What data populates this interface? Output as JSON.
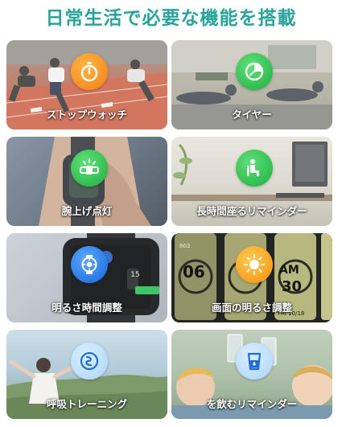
{
  "page_title": "日常生活で必要な機能を搭載",
  "features": [
    {
      "label": "ストップウォッチ",
      "icon": "stopwatch-icon",
      "color": "#f7931e"
    },
    {
      "label": "タイヤー",
      "icon": "timer-icon",
      "color": "#2fc24f"
    },
    {
      "label": "腕上げ点灯",
      "icon": "wrist-raise-icon",
      "color": "#2fc24f"
    },
    {
      "label": "長時間座るリマインダー",
      "icon": "sitting-person-icon",
      "color": "#2fc24f"
    },
    {
      "label": "明るさ時間調整",
      "icon": "watch-brightness-icon",
      "color": "#1e78e6"
    },
    {
      "label": "画面の明るさ調整",
      "icon": "sun-icon",
      "color": "#f7a21b"
    },
    {
      "label": "呼吸トレーニング",
      "icon": "breathing-icon",
      "color": "#a9d5ff"
    },
    {
      "label": "を飲むリマインダー",
      "icon": "water-glass-icon",
      "color": "#a9d5ff"
    }
  ],
  "watch_face": {
    "time_hour": "06",
    "time_minute": "30",
    "meridiem": "AM",
    "date": "FRI 10/18",
    "steps": "803",
    "pager_value": "15"
  }
}
